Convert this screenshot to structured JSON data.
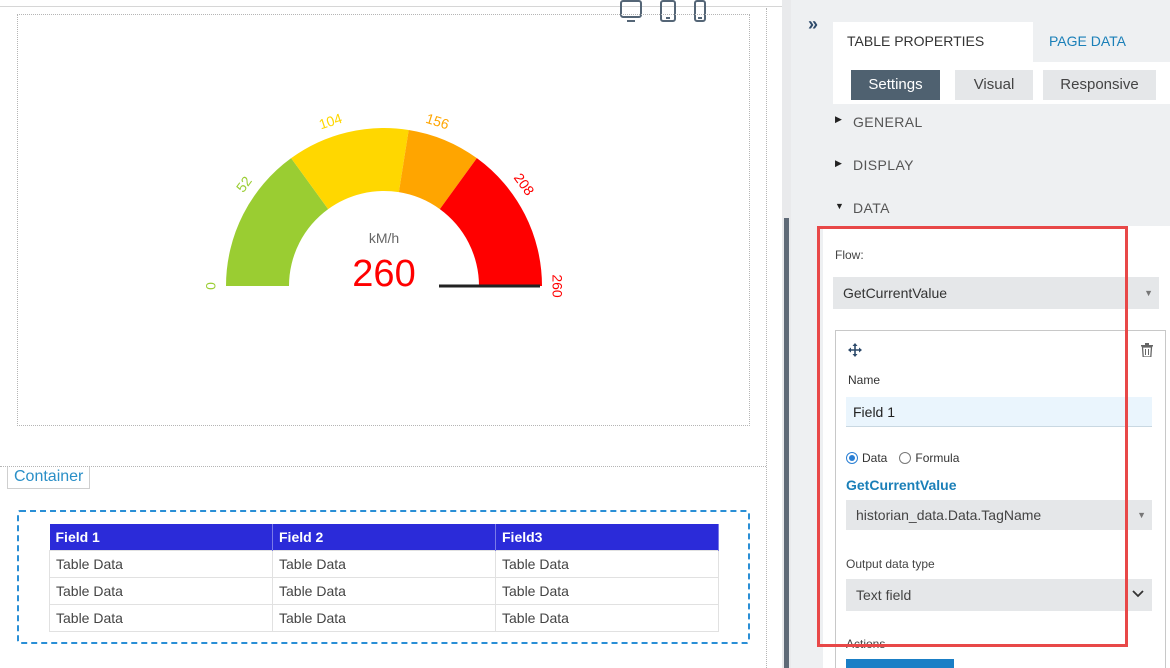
{
  "gauge": {
    "unit": "kM/h",
    "value": 260,
    "min": 0,
    "max": 260,
    "ticks": [
      "0",
      "52",
      "104",
      "156",
      "208",
      "260"
    ],
    "segments": [
      {
        "from": 0,
        "to": 78,
        "color": "#9ACD32"
      },
      {
        "from": 78,
        "to": 143,
        "color": "#FFD700"
      },
      {
        "from": 143,
        "to": 182,
        "color": "#FFA500"
      },
      {
        "from": 182,
        "to": 260,
        "color": "#FF0000"
      }
    ],
    "value_color": "#FF0000"
  },
  "container": {
    "label": "Container"
  },
  "table": {
    "headers": [
      "Field 1",
      "Field 2",
      "Field3"
    ],
    "rows": [
      [
        "Table Data",
        "Table Data",
        "Table Data"
      ],
      [
        "Table Data",
        "Table Data",
        "Table Data"
      ],
      [
        "Table Data",
        "Table Data",
        "Table Data"
      ]
    ],
    "header_color": "#2B2BD9"
  },
  "panel": {
    "collapse_glyph": "»",
    "tabs": [
      "TABLE PROPERTIES",
      "PAGE DATA"
    ],
    "subtabs": [
      "Settings",
      "Visual",
      "Responsive"
    ],
    "sections": {
      "general": "GENERAL",
      "display": "DISPLAY",
      "data": "DATA"
    },
    "flow_label": "Flow:",
    "flow_value": "GetCurrentValue",
    "field": {
      "name_label": "Name",
      "name_value": "Field 1",
      "radio_data": "Data",
      "radio_formula": "Formula",
      "function_name": "GetCurrentValue",
      "tag_value": "historian_data.Data.TagName",
      "output_label": "Output data type",
      "output_value": "Text field",
      "actions_label": "Actions"
    }
  }
}
